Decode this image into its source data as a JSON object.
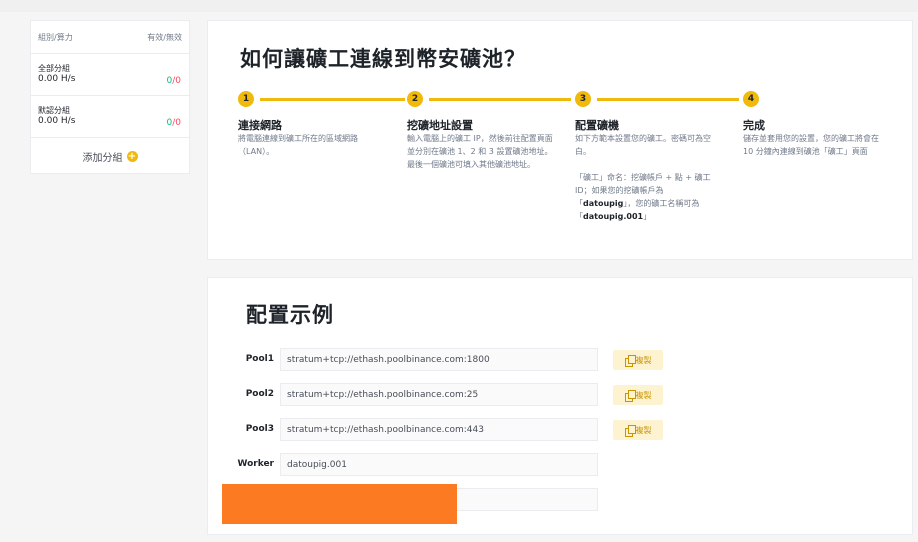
{
  "sidebar": {
    "header_left": "組別/算力",
    "header_right": "有效/無效",
    "groups": [
      {
        "name": "全部分組",
        "hashrate": "0.00 H/s",
        "valid": "0",
        "invalid": "0"
      },
      {
        "name": "默認分組",
        "hashrate": "0.00 H/s",
        "valid": "0",
        "invalid": "0"
      }
    ],
    "ratio_sep": "/",
    "add_group_label": "添加分組",
    "add_icon": "+"
  },
  "howto": {
    "title": "如何讓礦工連線到幣安礦池？",
    "steps": [
      {
        "num": "1",
        "title": "連接網路",
        "desc": "將電腦連線到礦工所在的區域網路（LAN）。"
      },
      {
        "num": "2",
        "title": "挖礦地址設置",
        "desc": "輸入電腦上的礦工 IP，然後前往配置頁面並分別在礦池 1、2 和 3 設置礦池地址。最後一個礦池可填入其他礦池地址。"
      },
      {
        "num": "3",
        "title": "配置礦機",
        "desc": "如下方範本設置您的礦工。密碼可為空白。",
        "desc2_a": "「礦工」命名：挖礦帳戶 + 點 + 礦工 ID；如果您的挖礦帳戶為「",
        "desc2_b": "datoupig",
        "desc2_c": "」，您的礦工名稱可為「",
        "desc2_d": "datoupig.001",
        "desc2_e": "」"
      },
      {
        "num": "4",
        "title": "完成",
        "desc": "儲存並套用您的設置，您的礦工將會在 10 分鐘內連線到礦池「礦工」頁面"
      }
    ]
  },
  "config": {
    "title": "配置示例",
    "copy_label": "複製",
    "rows": [
      {
        "label": "Pool1",
        "value": "stratum+tcp://ethash.poolbinance.com:1800"
      },
      {
        "label": "Pool2",
        "value": "stratum+tcp://ethash.poolbinance.com:25"
      },
      {
        "label": "Pool3",
        "value": "stratum+tcp://ethash.poolbinance.com:443"
      },
      {
        "label": "Worker",
        "value": "datoupig.001"
      }
    ]
  },
  "colors": {
    "accent": "#f0b90b",
    "valid": "#02c076",
    "invalid": "#f84960",
    "redaction": "#fc7a22"
  }
}
